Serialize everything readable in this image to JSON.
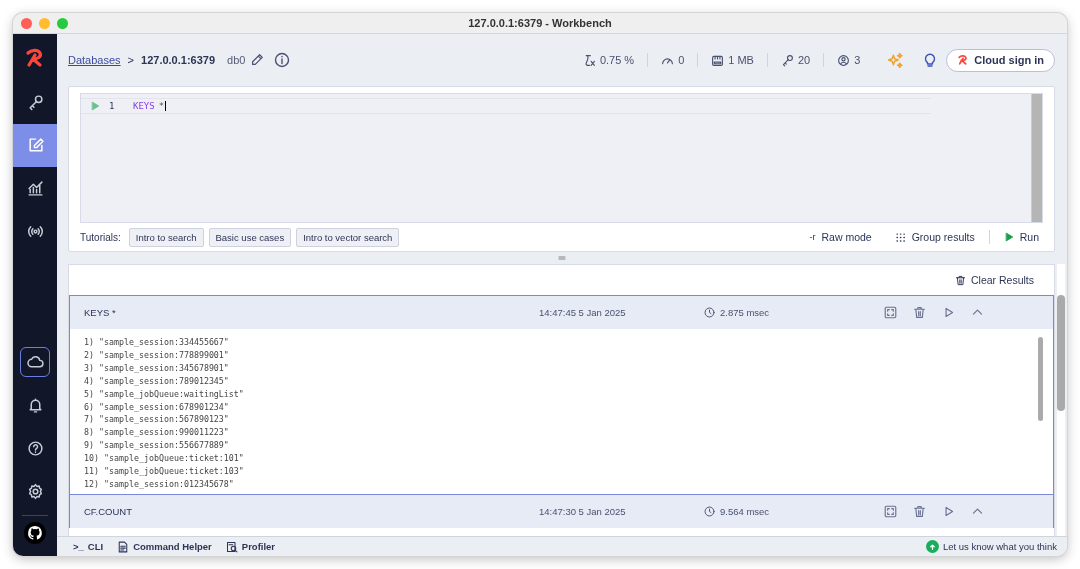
{
  "window": {
    "title": "127.0.0.1:6379 - Workbench"
  },
  "sidebar": {
    "items": [
      {
        "kind": "keys",
        "selected": false
      },
      {
        "kind": "workbench",
        "selected": true
      },
      {
        "kind": "analytics",
        "selected": false
      },
      {
        "kind": "pubsub",
        "selected": false
      }
    ],
    "bottom_items": [
      {
        "kind": "cloud"
      },
      {
        "kind": "bell"
      },
      {
        "kind": "help"
      },
      {
        "kind": "settings"
      },
      {
        "kind": "github"
      }
    ]
  },
  "header": {
    "breadcrumb_link": "Databases",
    "separator": ">",
    "database": "127.0.0.1:6379",
    "db_index": "db0",
    "stats": [
      {
        "kind": "cpu",
        "value": "0.75 %"
      },
      {
        "kind": "ops",
        "value": "0"
      },
      {
        "kind": "memory",
        "value": "1 MB"
      },
      {
        "kind": "keys",
        "value": "20"
      },
      {
        "kind": "clients",
        "value": "3"
      }
    ],
    "cloud_button": "Cloud sign in"
  },
  "editor": {
    "lines": [
      {
        "number": "1",
        "keyword": "KEYS",
        "args": "*"
      }
    ],
    "tutorials_label": "Tutorials:",
    "tutorials": [
      "Intro to search",
      "Basic use cases",
      "Intro to vector search"
    ],
    "raw_mode_icon": "-r",
    "raw_mode": "Raw mode",
    "group_results": "Group results",
    "run": "Run"
  },
  "results": {
    "clear": "Clear Results",
    "items": [
      {
        "command": "KEYS *",
        "time": "14:47:45 5 Jan 2025",
        "duration": "2.875 msec",
        "expanded": true,
        "output": [
          "1) \"sample_session:334455667\"",
          "2) \"sample_session:778899001\"",
          "3) \"sample_session:345678901\"",
          "4) \"sample_session:789012345\"",
          "5) \"sample_jobQueue:waitingList\"",
          "6) \"sample_session:678901234\"",
          "7) \"sample_session:567890123\"",
          "8) \"sample_session:990011223\"",
          "9) \"sample_session:556677889\"",
          "10) \"sample_jobQueue:ticket:101\"",
          "11) \"sample_jobQueue:ticket:103\"",
          "12) \"sample_session:012345678\""
        ]
      },
      {
        "command": "CF.COUNT",
        "time": "14:47:30 5 Jan 2025",
        "duration": "9.564 msec",
        "expanded": true
      }
    ]
  },
  "bottom_bar": {
    "items": [
      {
        "kind": "cli",
        "label": "CLI",
        "prefix": ">_"
      },
      {
        "kind": "helper",
        "label": "Command Helper"
      },
      {
        "kind": "profiler",
        "label": "Profiler"
      }
    ],
    "feedback": "Let us know what you think"
  }
}
